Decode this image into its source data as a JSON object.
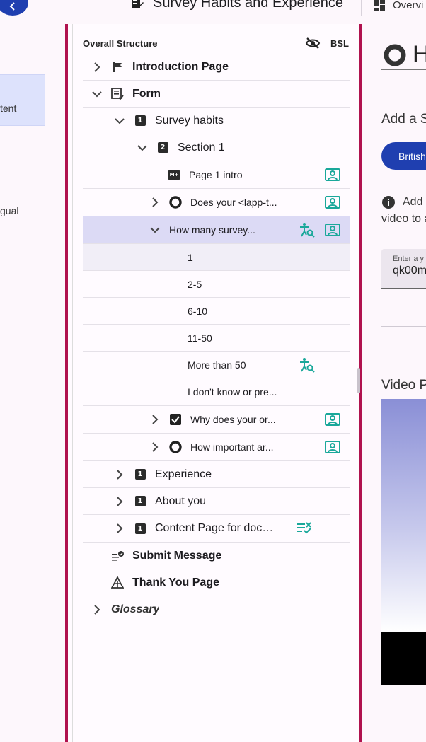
{
  "header": {
    "title": "Survey Habits and Experience",
    "overview_tab": "Overvi"
  },
  "leftnav": {
    "active_item": "tent",
    "item_2": "",
    "item_3": "gual"
  },
  "tree": {
    "header_title": "Overall Structure",
    "bsl_label": "BSL",
    "rows": [
      {
        "label": "Introduction Page"
      },
      {
        "label": "Form"
      },
      {
        "label": "Survey habits"
      },
      {
        "label": "Section 1"
      },
      {
        "label": "Page 1 intro"
      },
      {
        "label": "Does your <lapp-t..."
      },
      {
        "label": "How many survey..."
      },
      {
        "label": "1"
      },
      {
        "label": "2-5"
      },
      {
        "label": "6-10"
      },
      {
        "label": "11-50"
      },
      {
        "label": "More than 50"
      },
      {
        "label": "I don't know or pre..."
      },
      {
        "label": "Why does your or..."
      },
      {
        "label": "How important ar..."
      },
      {
        "label": "Experience"
      },
      {
        "label": "About you"
      },
      {
        "label": "Content Page for docu..."
      },
      {
        "label": "Submit Message"
      },
      {
        "label": "Thank You Page"
      },
      {
        "label": "Glossary"
      }
    ],
    "num_badges": {
      "one": "1",
      "two": "2"
    },
    "md_badge": "M+"
  },
  "right": {
    "title": "H",
    "add_heading": "Add a S",
    "pill_label": "British",
    "info_line1": "Add",
    "info_line2": "video to a",
    "input_label": "Enter a y",
    "input_value": "qk00m",
    "video_heading": "Video P"
  },
  "colors": {
    "primary": "#1f3fb0",
    "accent_border": "#b0124e",
    "teal_icon": "#1aa89a",
    "selected_row": "#dcdaf5"
  }
}
